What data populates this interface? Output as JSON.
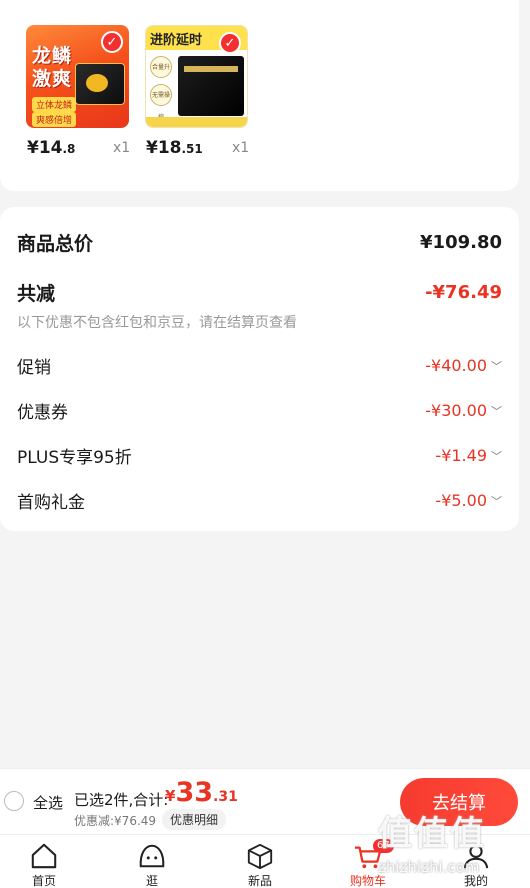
{
  "products": [
    {
      "price_int": "¥14",
      "price_dec": ".8",
      "qty": "x1",
      "image": {
        "title_line1": "龙鳞",
        "title_line2": "激爽",
        "tag1": "立体龙鳞",
        "tag2": "爽感倍增"
      }
    },
    {
      "price_int": "¥18",
      "price_dec": ".51",
      "qty": "x1",
      "image": {
        "title": "进阶延时",
        "chip1": "合量升级",
        "chip2": "无需操控"
      }
    }
  ],
  "summary": {
    "total_label": "商品总价",
    "total_value": "¥109.80",
    "reduce_label": "共减",
    "reduce_value": "-¥76.49",
    "note": "以下优惠不包含红包和京豆，请在结算页查看",
    "items": [
      {
        "label": "促销",
        "value": "-¥40.00"
      },
      {
        "label": "优惠券",
        "value": "-¥30.00"
      },
      {
        "label": "PLUS专享95折",
        "value": "-¥1.49"
      },
      {
        "label": "首购礼金",
        "value": "-¥5.00"
      }
    ]
  },
  "bottom_bar": {
    "select_all": "全选",
    "selected_text": "已选2件,合计:",
    "total_currency": "¥",
    "total_int": "33",
    "total_dec": ".31",
    "discount": "优惠减:¥76.49",
    "detail_button": "优惠明细",
    "checkout_button": "去结算"
  },
  "tabbar": [
    {
      "label": "首页",
      "icon": "home-icon"
    },
    {
      "label": "逛",
      "icon": "face-icon"
    },
    {
      "label": "新品",
      "icon": "cube-icon"
    },
    {
      "label": "购物车",
      "icon": "cart-icon",
      "badge": "67",
      "active": true
    },
    {
      "label": "我的",
      "icon": "user-icon"
    }
  ],
  "watermark": {
    "text": "值值值",
    "url": "zhizhizhi.com"
  },
  "colors": {
    "accent": "#e93323",
    "checkout": "#f53b2f"
  }
}
